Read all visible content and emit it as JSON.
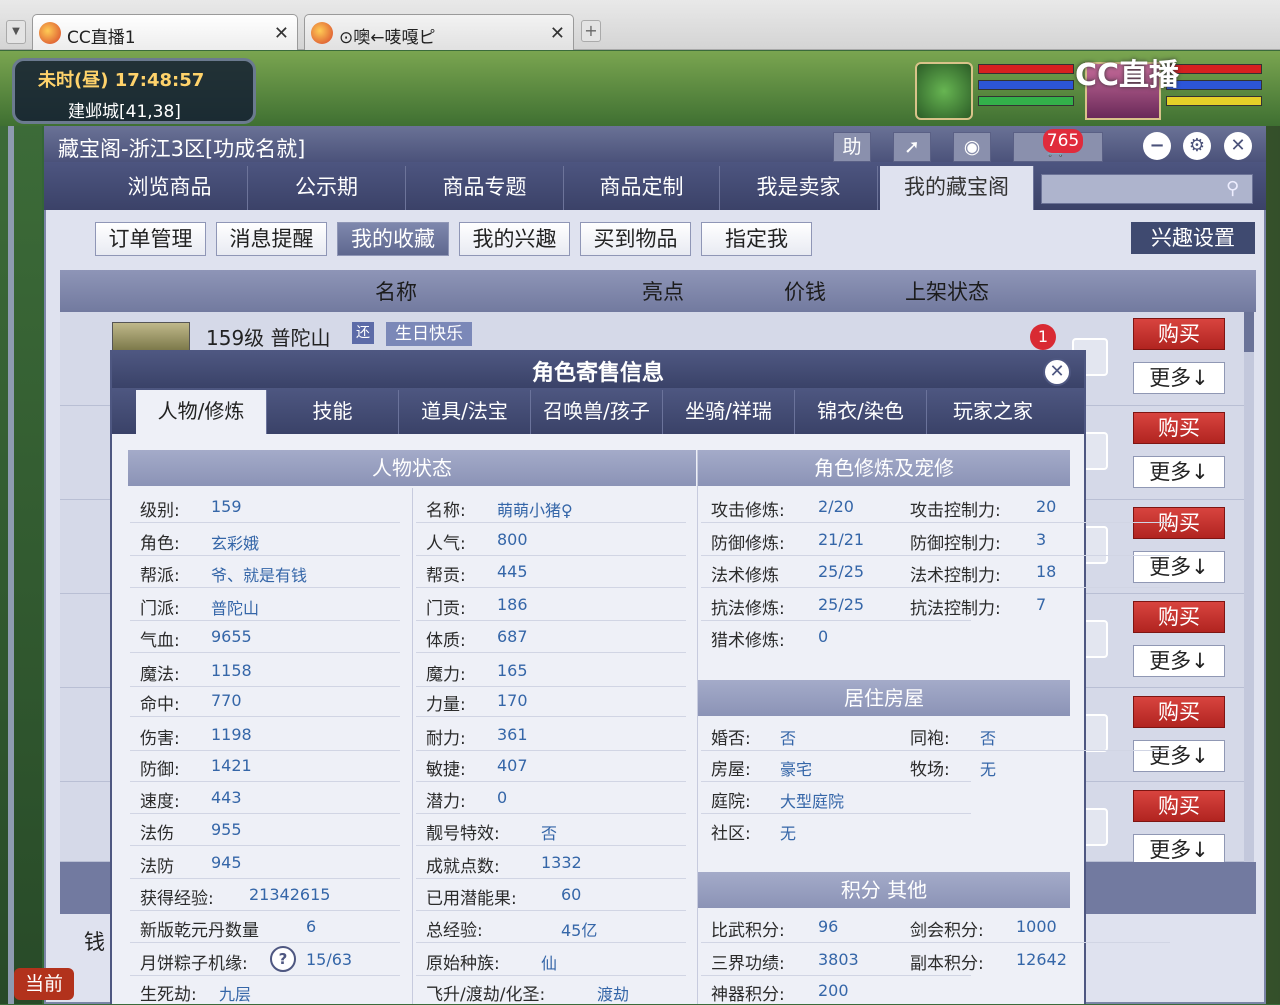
{
  "browser": {
    "tabs": [
      {
        "label": "CC直播1"
      },
      {
        "label": "⊙噢←唛嘎ピ"
      }
    ]
  },
  "game": {
    "time": "未时(昼)  17:48:57",
    "location": "建邺城[41,38]",
    "logo": "CC直播"
  },
  "window": {
    "title": "藏宝阁-浙江3区[功成名就]",
    "cart_count": "765",
    "nav": [
      "浏览商品",
      "公示期",
      "商品专题",
      "商品定制",
      "我是卖家",
      "我的藏宝阁"
    ],
    "sub_tabs": [
      "订单管理",
      "消息提醒",
      "我的收藏",
      "我的兴趣",
      "买到物品",
      "指定我"
    ],
    "interest_settings": "兴趣设置",
    "table_headers": [
      "名称",
      "亮点",
      "价钱",
      "上架状态"
    ],
    "row1": {
      "title": "159级 普陀山",
      "badge": "还",
      "tag": "生日快乐",
      "notify": "1"
    },
    "buy_label": "购买",
    "more_label": "更多↓",
    "bottom_left": "钱",
    "dock_label": "当前"
  },
  "popup": {
    "title": "角色寄售信息",
    "tabs": [
      "人物/修炼",
      "技能",
      "道具/法宝",
      "召唤兽/孩子",
      "坐骑/祥瑞",
      "锦衣/染色",
      "玩家之家"
    ],
    "status_title": "人物状态",
    "status_left": [
      {
        "label": "级别:",
        "value": "159"
      },
      {
        "label": "角色:",
        "value": "玄彩娥"
      },
      {
        "label": "帮派:",
        "value": "爷、就是有钱"
      },
      {
        "label": "门派:",
        "value": "普陀山"
      },
      {
        "label": "气血:",
        "value": "9655"
      },
      {
        "label": "魔法:",
        "value": "1158"
      },
      {
        "label": "命中:",
        "value": "770"
      },
      {
        "label": "伤害:",
        "value": "1198"
      },
      {
        "label": "防御:",
        "value": "1421"
      },
      {
        "label": "速度:",
        "value": "443"
      },
      {
        "label": "法伤",
        "value": "955"
      },
      {
        "label": "法防",
        "value": "945"
      },
      {
        "label": "获得经验:",
        "value": "21342615"
      },
      {
        "label": "新版乾元丹数量",
        "value": "6"
      },
      {
        "label": "月饼粽子机缘:",
        "value": "15/63"
      },
      {
        "label": "生死劫:",
        "value": "九层"
      }
    ],
    "status_right": [
      {
        "label": "名称:",
        "value": "萌萌小猪♀"
      },
      {
        "label": "人气:",
        "value": "800"
      },
      {
        "label": "帮贡:",
        "value": "445"
      },
      {
        "label": "门贡:",
        "value": "186"
      },
      {
        "label": "体质:",
        "value": "687"
      },
      {
        "label": "魔力:",
        "value": "165"
      },
      {
        "label": "力量:",
        "value": "170"
      },
      {
        "label": "耐力:",
        "value": "361"
      },
      {
        "label": "敏捷:",
        "value": "407"
      },
      {
        "label": "潜力:",
        "value": "0"
      },
      {
        "label": "靓号特效:",
        "value": "否"
      },
      {
        "label": "成就点数:",
        "value": "1332"
      },
      {
        "label": "已用潜能果:",
        "value": "60"
      },
      {
        "label": "总经验:",
        "value": "45亿"
      },
      {
        "label": "原始种族:",
        "value": "仙"
      },
      {
        "label": "飞升/渡劫/化圣:",
        "value": "渡劫"
      }
    ],
    "train_title": "角色修炼及宠修",
    "train_left": [
      {
        "label": "攻击修炼:",
        "value": "2/20"
      },
      {
        "label": "防御修炼:",
        "value": "21/21"
      },
      {
        "label": "法术修炼",
        "value": "25/25"
      },
      {
        "label": "抗法修炼:",
        "value": "25/25"
      },
      {
        "label": "猎术修炼:",
        "value": "0"
      }
    ],
    "train_right": [
      {
        "label": "攻击控制力:",
        "value": "20"
      },
      {
        "label": "防御控制力:",
        "value": "3"
      },
      {
        "label": "法术控制力:",
        "value": "18"
      },
      {
        "label": "抗法控制力:",
        "value": "7"
      }
    ],
    "house_title": "居住房屋",
    "house_left": [
      {
        "label": "婚否:",
        "value": "否"
      },
      {
        "label": "房屋:",
        "value": "豪宅"
      },
      {
        "label": "庭院:",
        "value": "大型庭院"
      },
      {
        "label": "社区:",
        "value": "无"
      }
    ],
    "house_right": [
      {
        "label": "同袍:",
        "value": "否"
      },
      {
        "label": "牧场:",
        "value": "无"
      }
    ],
    "score_title": "积分 其他",
    "score_left": [
      {
        "label": "比武积分:",
        "value": "96"
      },
      {
        "label": "三界功绩:",
        "value": "3803"
      },
      {
        "label": "神器积分:",
        "value": "200"
      }
    ],
    "score_right": [
      {
        "label": "剑会积分:",
        "value": "1000"
      },
      {
        "label": "副本积分:",
        "value": "12642"
      }
    ],
    "help": "?"
  }
}
